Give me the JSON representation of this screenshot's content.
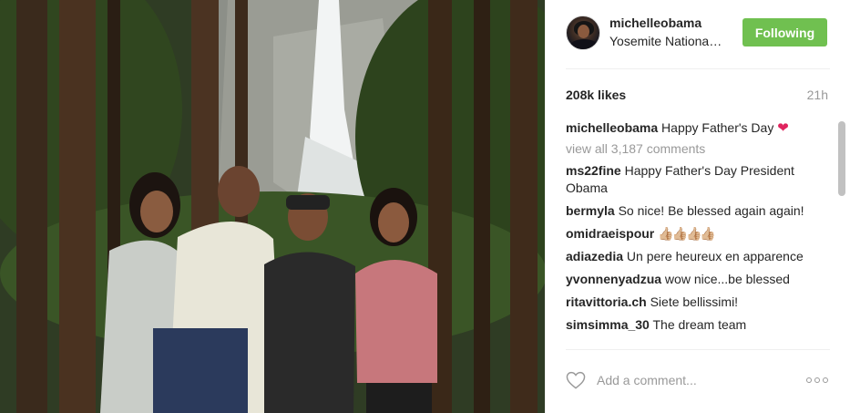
{
  "post": {
    "photo_alt": "",
    "user": {
      "username": "michelleobama",
      "location": "Yosemite Nationa…",
      "follow_label": "Following"
    },
    "likes": "208k likes",
    "time": "21h",
    "caption": {
      "username": "michelleobama",
      "text": "Happy Father's Day "
    },
    "view_all": "view all 3,187 comments",
    "comments": [
      {
        "username": "ms22fine",
        "text": "Happy Father's Day President Obama"
      },
      {
        "username": "bermyla",
        "text": "So nice! Be blessed again again!"
      },
      {
        "username": "omidraeispour",
        "text": "👍🏼👍🏼👍🏼👍🏼"
      },
      {
        "username": "adiazedia",
        "text": "Un pere heureux en apparence"
      },
      {
        "username": "yvonnenyadzua",
        "text": "wow nice...be blessed"
      },
      {
        "username": "ritavittoria.ch",
        "text": "Siete bellissimi!"
      },
      {
        "username": "simsimma_30",
        "text": "The dream team"
      }
    ],
    "add_comment_placeholder": "Add a comment...",
    "icons": {
      "heart": "heart-outline-icon",
      "more": "more-options-icon",
      "caption_emoji": "red-heart-emoji"
    },
    "colors": {
      "follow_button": "#70c050",
      "muted_text": "#999999",
      "heart": "#e0245e"
    }
  }
}
